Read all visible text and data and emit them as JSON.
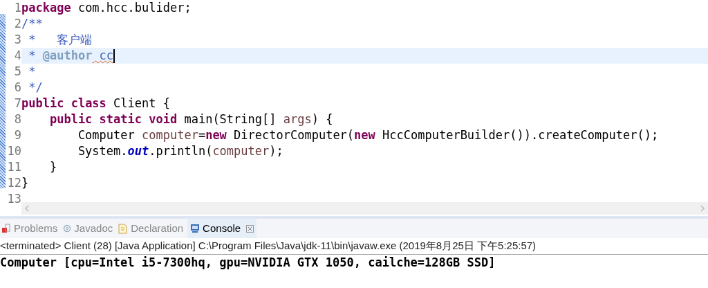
{
  "editor": {
    "lines": [
      {
        "number": "1",
        "current": false,
        "tokens": [
          {
            "kind": "kw",
            "text": "package"
          },
          {
            "kind": "text",
            "text": " com.hcc.bulider;"
          }
        ]
      },
      {
        "number": "2",
        "current": false,
        "tokens": [
          {
            "kind": "comment",
            "text": "/**"
          }
        ]
      },
      {
        "number": "3",
        "current": false,
        "tokens": [
          {
            "kind": "comment",
            "text": " *   客户端"
          }
        ]
      },
      {
        "number": "4",
        "current": true,
        "tokens": [
          {
            "kind": "comment",
            "text": " * "
          },
          {
            "kind": "tag",
            "text": "@author"
          },
          {
            "kind": "comment",
            "text": " cc",
            "misspelled": true
          }
        ]
      },
      {
        "number": "5",
        "current": false,
        "tokens": [
          {
            "kind": "comment",
            "text": " *"
          }
        ]
      },
      {
        "number": "6",
        "current": false,
        "tokens": [
          {
            "kind": "comment",
            "text": " */"
          }
        ]
      },
      {
        "number": "7",
        "current": false,
        "tokens": [
          {
            "kind": "kw",
            "text": "public"
          },
          {
            "kind": "kw",
            "text": " class"
          },
          {
            "kind": "text",
            "text": " Client {"
          }
        ]
      },
      {
        "number": "8",
        "current": false,
        "tokens": [
          {
            "kind": "kw",
            "text": "    public"
          },
          {
            "kind": "kw",
            "text": " static"
          },
          {
            "kind": "kw",
            "text": " void"
          },
          {
            "kind": "text",
            "text": " main(String[] "
          },
          {
            "kind": "var",
            "text": "args"
          },
          {
            "kind": "text",
            "text": ") {"
          }
        ]
      },
      {
        "number": "9",
        "current": false,
        "tokens": [
          {
            "kind": "text",
            "text": "        Computer "
          },
          {
            "kind": "var",
            "text": "computer"
          },
          {
            "kind": "text",
            "text": "="
          },
          {
            "kind": "kw",
            "text": "new"
          },
          {
            "kind": "text",
            "text": " DirectorComputer("
          },
          {
            "kind": "kw",
            "text": "new"
          },
          {
            "kind": "text",
            "text": " HccComputerBuilder()).createComputer();"
          }
        ]
      },
      {
        "number": "10",
        "current": false,
        "tokens": [
          {
            "kind": "text",
            "text": "        System."
          },
          {
            "kind": "field",
            "text": "out"
          },
          {
            "kind": "text",
            "text": ".println("
          },
          {
            "kind": "var",
            "text": "computer"
          },
          {
            "kind": "text",
            "text": ");"
          }
        ]
      },
      {
        "number": "11",
        "current": false,
        "tokens": [
          {
            "kind": "text",
            "text": "    }"
          }
        ]
      },
      {
        "number": "12",
        "current": false,
        "tokens": [
          {
            "kind": "text",
            "text": "}"
          }
        ]
      },
      {
        "number": "13",
        "current": false
      }
    ]
  },
  "tabs": [
    {
      "label": "Problems",
      "selected": false,
      "closable": false
    },
    {
      "label": "Javadoc",
      "selected": false,
      "closable": false
    },
    {
      "label": "Declaration",
      "selected": false,
      "closable": false
    },
    {
      "label": "Console",
      "selected": true,
      "closable": true
    }
  ],
  "console": {
    "header": "<terminated> Client (28) [Java Application] C:\\Program Files\\Java\\jdk-11\\bin\\javaw.exe (2019年8月25日 下午5:25:57)",
    "output": "Computer [cpu=Intel i5-7300hq, gpu=NVIDIA GTX 1050, cailche=128GB SSD]"
  }
}
